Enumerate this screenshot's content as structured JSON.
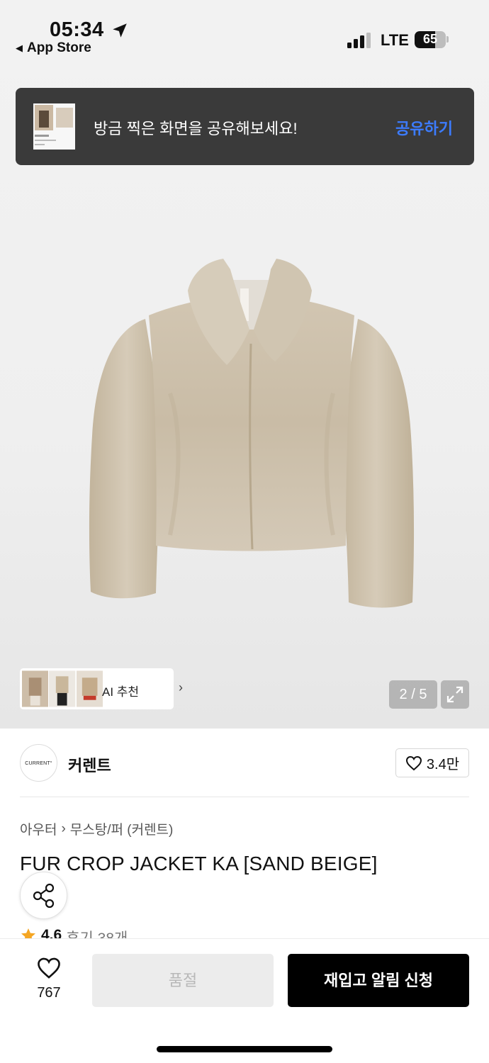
{
  "status_bar": {
    "time": "05:34",
    "back_app": "App Store",
    "network": "LTE",
    "battery": "65",
    "battery_level": 0.65
  },
  "toast": {
    "message": "방금 찍은 화면을 공유해보세요!",
    "action": "공유하기"
  },
  "gallery": {
    "ai_label": "AI 추천",
    "page_current": "2",
    "page_total": "5",
    "page_indicator": "2 / 5"
  },
  "brand": {
    "logo_text": "CURRENT°",
    "name": "커렌트",
    "likes": "3.4만"
  },
  "breadcrumb": {
    "category": "아우터",
    "separator": "›",
    "subcategory": "무스탕/퍼 (커렌트)"
  },
  "product": {
    "title": "FUR CROP JACKET KA [SAND BEIGE]",
    "rating": "4.6",
    "reviews": "후기 38개"
  },
  "bottom_bar": {
    "wish_count": "767",
    "soldout_label": "품절",
    "restock_label": "재입고 알림 신청"
  },
  "colors": {
    "toast_bg": "#3a3a3a",
    "toast_action": "#3c7cff",
    "primary_button": "#000000",
    "disabled_button": "#ececec",
    "star": "#f5a623"
  },
  "icons": {
    "location": "location-arrow-icon",
    "signal": "cellular-signal-icon",
    "heart": "heart-icon",
    "share": "share-icon",
    "expand": "expand-icon",
    "star": "star-icon",
    "chevron": "chevron-right-icon"
  }
}
